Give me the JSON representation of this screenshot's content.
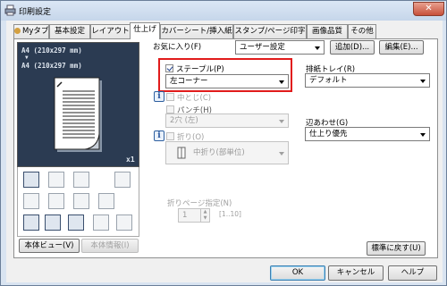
{
  "window": {
    "title": "印刷設定",
    "close": "✕"
  },
  "tabs": [
    {
      "label": "Myタブ",
      "active": false
    },
    {
      "label": "基本設定",
      "active": false
    },
    {
      "label": "レイアウト",
      "active": false
    },
    {
      "label": "仕上げ",
      "active": true
    },
    {
      "label": "カバーシート/挿入紙",
      "active": false
    },
    {
      "label": "スタンプ/ページ印字",
      "active": false
    },
    {
      "label": "画像品質",
      "active": false
    },
    {
      "label": "その他",
      "active": false
    }
  ],
  "preview": {
    "line1": "A4 (210x297 mm)",
    "arrow": "▼",
    "line2": "A4 (210x297 mm)",
    "copies": "x1"
  },
  "favorites": {
    "label": "お気に入り(F)",
    "value": "ユーザー設定",
    "add": "追加(D)...",
    "edit": "編集(E)..."
  },
  "staple": {
    "label": "ステープル(P)",
    "checked": true,
    "value": "左コーナー"
  },
  "center_staple": {
    "label": "中とじ(C)"
  },
  "punch": {
    "label": "パンチ(H)",
    "value": "2穴 (左)"
  },
  "fold": {
    "label": "折り(O)",
    "value": "中折り(部単位)"
  },
  "fold_page": {
    "label": "折りページ指定(N)",
    "value": "1",
    "range": "[1..10]"
  },
  "output_tray": {
    "label": "排紙トレイ(R)",
    "value": "デフォルト"
  },
  "collate": {
    "label": "辺あわせ(G)",
    "value": "仕上り優先"
  },
  "buttons": {
    "body_view": "本体ビュー(V)",
    "body_info": "本体情報(I)",
    "restore": "標準に戻す(U)",
    "ok": "OK",
    "cancel": "キャンセル",
    "help": "ヘルプ"
  }
}
